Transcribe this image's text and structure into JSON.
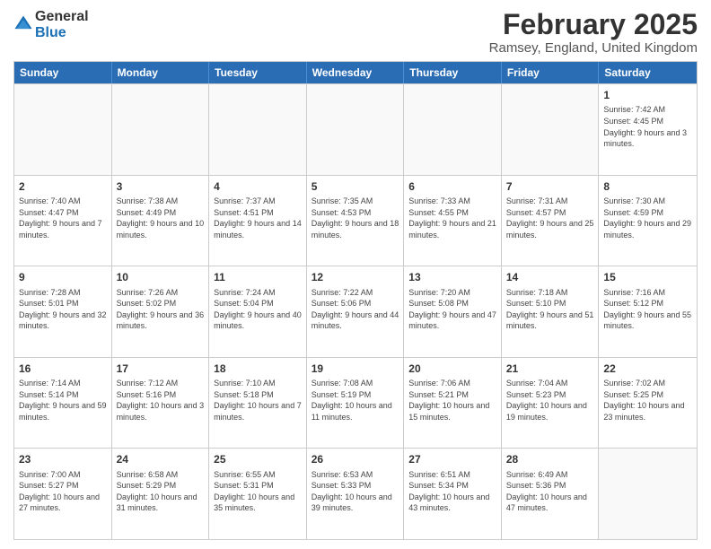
{
  "header": {
    "logo_line1": "General",
    "logo_line2": "Blue",
    "title": "February 2025",
    "subtitle": "Ramsey, England, United Kingdom"
  },
  "calendar": {
    "days_of_week": [
      "Sunday",
      "Monday",
      "Tuesday",
      "Wednesday",
      "Thursday",
      "Friday",
      "Saturday"
    ],
    "weeks": [
      [
        {
          "day": "",
          "info": ""
        },
        {
          "day": "",
          "info": ""
        },
        {
          "day": "",
          "info": ""
        },
        {
          "day": "",
          "info": ""
        },
        {
          "day": "",
          "info": ""
        },
        {
          "day": "",
          "info": ""
        },
        {
          "day": "1",
          "info": "Sunrise: 7:42 AM\nSunset: 4:45 PM\nDaylight: 9 hours and 3 minutes."
        }
      ],
      [
        {
          "day": "2",
          "info": "Sunrise: 7:40 AM\nSunset: 4:47 PM\nDaylight: 9 hours and 7 minutes."
        },
        {
          "day": "3",
          "info": "Sunrise: 7:38 AM\nSunset: 4:49 PM\nDaylight: 9 hours and 10 minutes."
        },
        {
          "day": "4",
          "info": "Sunrise: 7:37 AM\nSunset: 4:51 PM\nDaylight: 9 hours and 14 minutes."
        },
        {
          "day": "5",
          "info": "Sunrise: 7:35 AM\nSunset: 4:53 PM\nDaylight: 9 hours and 18 minutes."
        },
        {
          "day": "6",
          "info": "Sunrise: 7:33 AM\nSunset: 4:55 PM\nDaylight: 9 hours and 21 minutes."
        },
        {
          "day": "7",
          "info": "Sunrise: 7:31 AM\nSunset: 4:57 PM\nDaylight: 9 hours and 25 minutes."
        },
        {
          "day": "8",
          "info": "Sunrise: 7:30 AM\nSunset: 4:59 PM\nDaylight: 9 hours and 29 minutes."
        }
      ],
      [
        {
          "day": "9",
          "info": "Sunrise: 7:28 AM\nSunset: 5:01 PM\nDaylight: 9 hours and 32 minutes."
        },
        {
          "day": "10",
          "info": "Sunrise: 7:26 AM\nSunset: 5:02 PM\nDaylight: 9 hours and 36 minutes."
        },
        {
          "day": "11",
          "info": "Sunrise: 7:24 AM\nSunset: 5:04 PM\nDaylight: 9 hours and 40 minutes."
        },
        {
          "day": "12",
          "info": "Sunrise: 7:22 AM\nSunset: 5:06 PM\nDaylight: 9 hours and 44 minutes."
        },
        {
          "day": "13",
          "info": "Sunrise: 7:20 AM\nSunset: 5:08 PM\nDaylight: 9 hours and 47 minutes."
        },
        {
          "day": "14",
          "info": "Sunrise: 7:18 AM\nSunset: 5:10 PM\nDaylight: 9 hours and 51 minutes."
        },
        {
          "day": "15",
          "info": "Sunrise: 7:16 AM\nSunset: 5:12 PM\nDaylight: 9 hours and 55 minutes."
        }
      ],
      [
        {
          "day": "16",
          "info": "Sunrise: 7:14 AM\nSunset: 5:14 PM\nDaylight: 9 hours and 59 minutes."
        },
        {
          "day": "17",
          "info": "Sunrise: 7:12 AM\nSunset: 5:16 PM\nDaylight: 10 hours and 3 minutes."
        },
        {
          "day": "18",
          "info": "Sunrise: 7:10 AM\nSunset: 5:18 PM\nDaylight: 10 hours and 7 minutes."
        },
        {
          "day": "19",
          "info": "Sunrise: 7:08 AM\nSunset: 5:19 PM\nDaylight: 10 hours and 11 minutes."
        },
        {
          "day": "20",
          "info": "Sunrise: 7:06 AM\nSunset: 5:21 PM\nDaylight: 10 hours and 15 minutes."
        },
        {
          "day": "21",
          "info": "Sunrise: 7:04 AM\nSunset: 5:23 PM\nDaylight: 10 hours and 19 minutes."
        },
        {
          "day": "22",
          "info": "Sunrise: 7:02 AM\nSunset: 5:25 PM\nDaylight: 10 hours and 23 minutes."
        }
      ],
      [
        {
          "day": "23",
          "info": "Sunrise: 7:00 AM\nSunset: 5:27 PM\nDaylight: 10 hours and 27 minutes."
        },
        {
          "day": "24",
          "info": "Sunrise: 6:58 AM\nSunset: 5:29 PM\nDaylight: 10 hours and 31 minutes."
        },
        {
          "day": "25",
          "info": "Sunrise: 6:55 AM\nSunset: 5:31 PM\nDaylight: 10 hours and 35 minutes."
        },
        {
          "day": "26",
          "info": "Sunrise: 6:53 AM\nSunset: 5:33 PM\nDaylight: 10 hours and 39 minutes."
        },
        {
          "day": "27",
          "info": "Sunrise: 6:51 AM\nSunset: 5:34 PM\nDaylight: 10 hours and 43 minutes."
        },
        {
          "day": "28",
          "info": "Sunrise: 6:49 AM\nSunset: 5:36 PM\nDaylight: 10 hours and 47 minutes."
        },
        {
          "day": "",
          "info": ""
        }
      ]
    ]
  }
}
